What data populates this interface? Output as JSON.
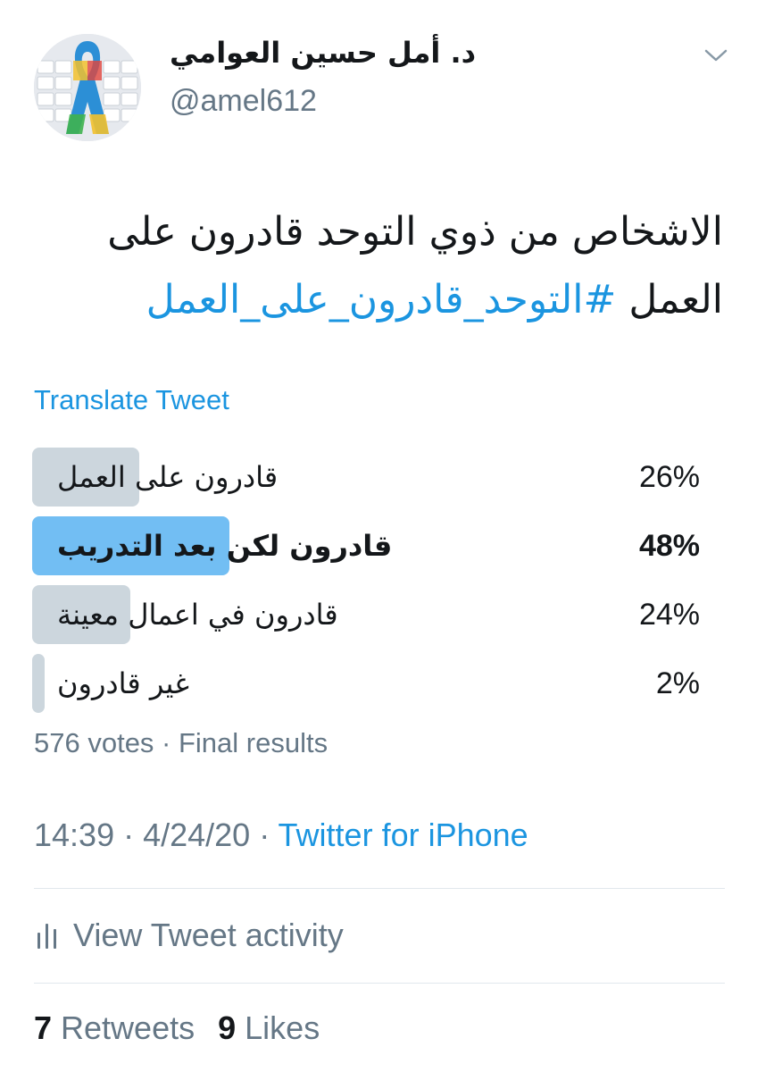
{
  "user": {
    "display_name": "د. أمل حسين العوامي",
    "handle": "@amel612"
  },
  "tweet": {
    "text_plain": "الاشخاص من ذوي التوحد قادرون على العمل ",
    "hashtag": "#التوحد_قادرون_على_العمل",
    "translate_label": "Translate Tweet"
  },
  "poll": {
    "options": [
      {
        "label": "قادرون على العمل",
        "percent_label": "26%",
        "percent": 26,
        "winner": false
      },
      {
        "label": "قادرون لكن بعد التدريب",
        "percent_label": "48%",
        "percent": 48,
        "winner": true
      },
      {
        "label": "قادرون في اعمال معينة",
        "percent_label": "24%",
        "percent": 24,
        "winner": false
      },
      {
        "label": "غير قادرون",
        "percent_label": "2%",
        "percent": 2,
        "winner": false
      }
    ],
    "summary": "576 votes · Final results",
    "colors": {
      "winner_bar": "#72bef3",
      "other_bar": "#ccd6dd"
    }
  },
  "meta": {
    "time_date": "14:39 · 4/24/20 · ",
    "source": "Twitter for iPhone"
  },
  "activity": {
    "label": "View Tweet activity",
    "icon": "bar-chart-icon"
  },
  "stats": {
    "retweets_count": "7",
    "retweets_label": " Retweets",
    "likes_count": "9",
    "likes_label": " Likes"
  },
  "colors": {
    "link": "#1b95e0",
    "secondary_text": "#657786",
    "primary_text": "#14171a",
    "divider": "#e1e8ed"
  }
}
